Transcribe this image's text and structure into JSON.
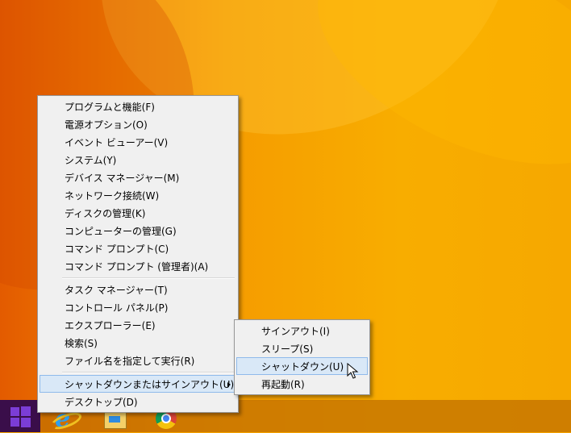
{
  "colors": {
    "desktop_accent": "#f5a300",
    "menu_background": "#f0f0f0",
    "highlight": "#d9e8f7",
    "highlight_border": "#8fbaeb",
    "start_button": "#3a0e4a"
  },
  "taskbar": {
    "icons": [
      "windows-start-icon",
      "internet-explorer-icon",
      "file-explorer-icon",
      "chrome-icon"
    ]
  },
  "context_menu": {
    "groups": [
      [
        "プログラムと機能(F)",
        "電源オプション(O)",
        "イベント ビューアー(V)",
        "システム(Y)",
        "デバイス マネージャー(M)",
        "ネットワーク接続(W)",
        "ディスクの管理(K)",
        "コンピューターの管理(G)",
        "コマンド プロンプト(C)",
        "コマンド プロンプト (管理者)(A)"
      ],
      [
        "タスク マネージャー(T)",
        "コントロール パネル(P)",
        "エクスプローラー(E)",
        "検索(S)",
        "ファイル名を指定して実行(R)"
      ],
      [
        "シャットダウンまたはサインアウト(U)",
        "デスクトップ(D)"
      ]
    ],
    "highlighted": "シャットダウンまたはサインアウト(U)"
  },
  "submenu": {
    "items": [
      "サインアウト(I)",
      "スリープ(S)",
      "シャットダウン(U)",
      "再起動(R)"
    ],
    "highlighted": "シャットダウン(U)"
  }
}
